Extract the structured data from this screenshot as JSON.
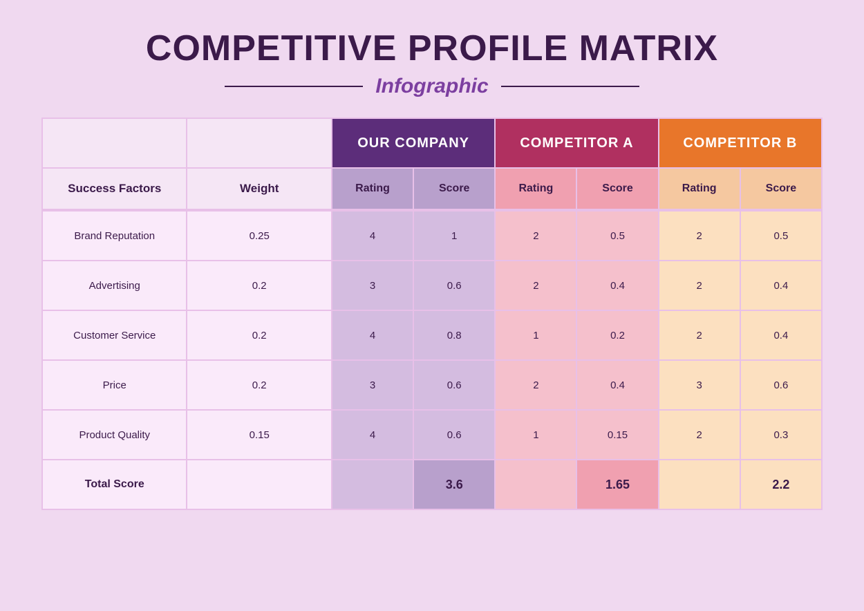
{
  "title": "COMPETITIVE PROFILE MATRIX",
  "subtitle": "Infographic",
  "headers": {
    "our_company": "OUR COMPANY",
    "comp_a": "COMPETITOR A",
    "comp_b": "COMPETITOR B",
    "success_factors": "Success Factors",
    "weight": "Weight",
    "rating": "Rating",
    "score": "Score",
    "total_score": "Total Score"
  },
  "rows": [
    {
      "factor": "Brand Reputation",
      "weight": "0.25",
      "our_rating": "4",
      "our_score": "1",
      "a_rating": "2",
      "a_score": "0.5",
      "b_rating": "2",
      "b_score": "0.5"
    },
    {
      "factor": "Advertising",
      "weight": "0.2",
      "our_rating": "3",
      "our_score": "0.6",
      "a_rating": "2",
      "a_score": "0.4",
      "b_rating": "2",
      "b_score": "0.4"
    },
    {
      "factor": "Customer Service",
      "weight": "0.2",
      "our_rating": "4",
      "our_score": "0.8",
      "a_rating": "1",
      "a_score": "0.2",
      "b_rating": "2",
      "b_score": "0.4"
    },
    {
      "factor": "Price",
      "weight": "0.2",
      "our_rating": "3",
      "our_score": "0.6",
      "a_rating": "2",
      "a_score": "0.4",
      "b_rating": "3",
      "b_score": "0.6"
    },
    {
      "factor": "Product Quality",
      "weight": "0.15",
      "our_rating": "4",
      "our_score": "0.6",
      "a_rating": "1",
      "a_score": "0.15",
      "b_rating": "2",
      "b_score": "0.3"
    }
  ],
  "totals": {
    "our_score": "3.6",
    "a_score": "1.65",
    "b_score": "2.2"
  }
}
